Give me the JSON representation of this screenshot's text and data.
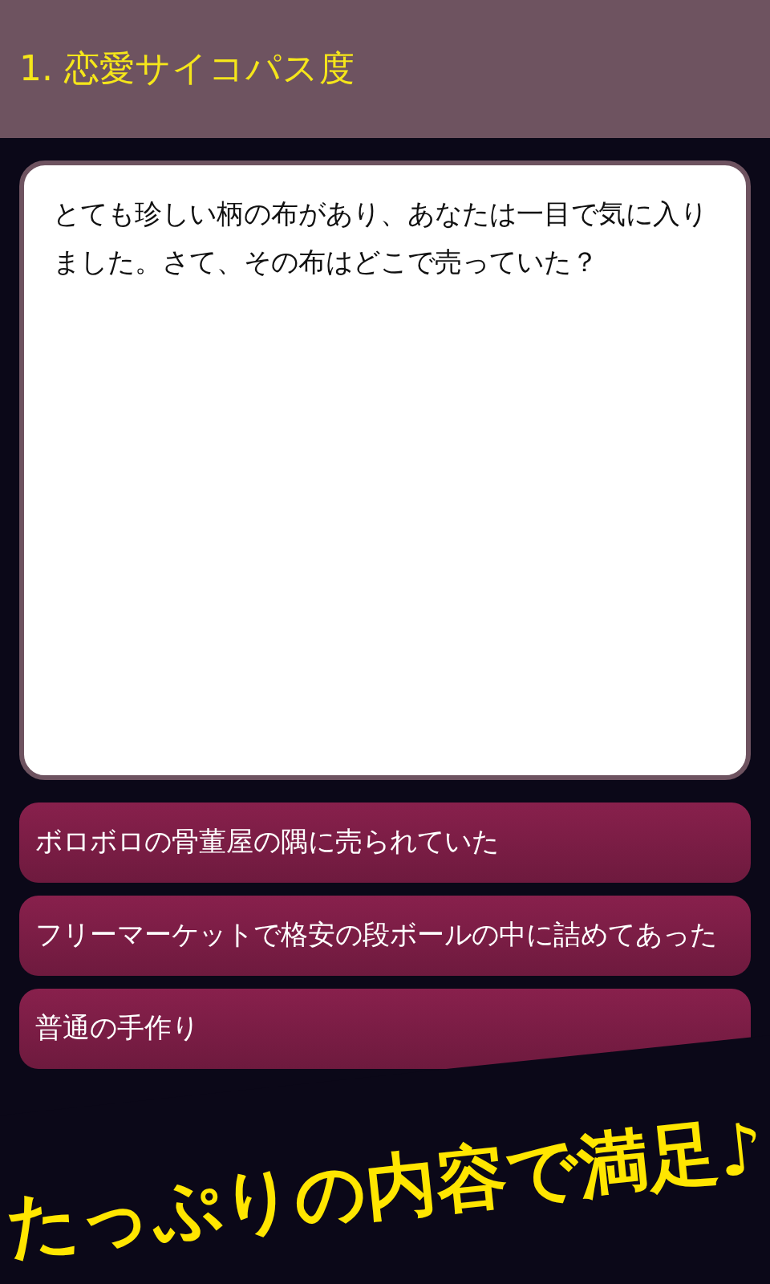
{
  "header": {
    "title": "1. 恋愛サイコパス度"
  },
  "question": {
    "text": "とても珍しい柄の布があり、あなたは一目で気に入りました。さて、その布はどこで売っていた？"
  },
  "options": [
    {
      "label": "ボロボロの骨董屋の隅に売られていた"
    },
    {
      "label": "フリーマーケットで格安の段ボールの中に詰めてあった"
    },
    {
      "label": "普通の手作り"
    }
  ],
  "banner": {
    "text": "たっぷりの内容で満足♪"
  }
}
